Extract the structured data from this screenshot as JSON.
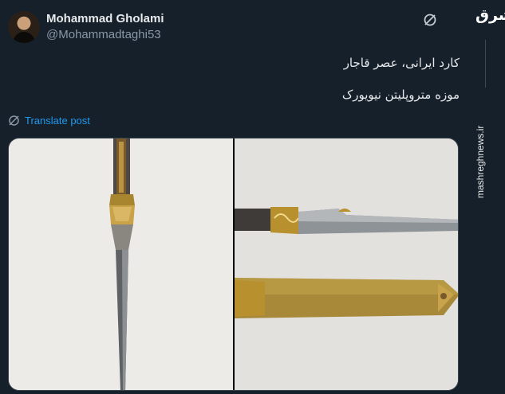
{
  "post": {
    "author_name": "Mohammad Gholami",
    "author_handle": "@Mohammadtaghi53",
    "text_line_1": "کارد ایرانی، عصر قاجار",
    "text_line_2": "موزه متروپلیتن نیویورک",
    "translate_label": "Translate post"
  },
  "watermark": {
    "logo_text": "مشرق",
    "site_url": "mashreghnews.ir"
  },
  "icons": {
    "avatar": "author-avatar",
    "grok": "grok-icon",
    "translate": "translate-icon"
  },
  "colors": {
    "background": "#15202b",
    "link": "#1d9bf0",
    "secondary_text": "#8b98a5",
    "gold": "#b8902e",
    "steel": "#6e7478"
  }
}
